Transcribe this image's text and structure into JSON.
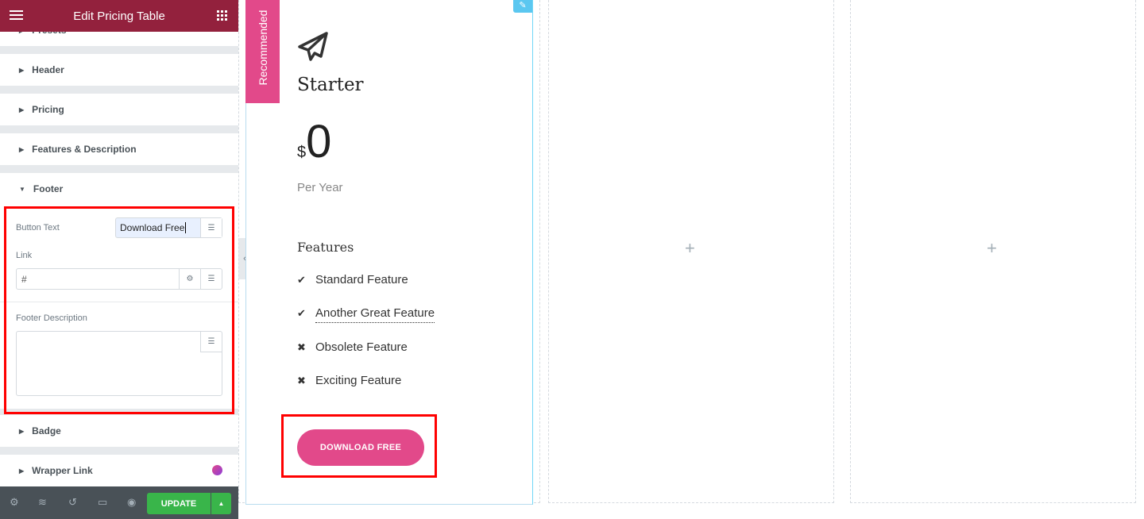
{
  "panel": {
    "title": "Edit Pricing Table",
    "menu_icon": "hamburger-icon",
    "grid_icon": "grid-icon"
  },
  "sections": {
    "presets": "Presets",
    "header": "Header",
    "pricing": "Pricing",
    "features": "Features & Description",
    "footer": "Footer",
    "badge": "Badge",
    "wrapper_link": "Wrapper Link"
  },
  "footer_controls": {
    "button_text_label": "Button Text",
    "button_text_value": "Download Free",
    "link_label": "Link",
    "link_value": "#",
    "description_label": "Footer Description",
    "description_value": ""
  },
  "bottom": {
    "update": "UPDATE"
  },
  "card": {
    "badge": "Recommended",
    "title": "Starter",
    "currency": "$",
    "price": "0",
    "period": "Per Year",
    "features_title": "Features",
    "features": [
      {
        "text": "Standard Feature",
        "icon": "check"
      },
      {
        "text": "Another Great Feature",
        "icon": "check"
      },
      {
        "text": "Obsolete Feature",
        "icon": "times"
      },
      {
        "text": "Exciting Feature",
        "icon": "times"
      }
    ],
    "button": "DOWNLOAD FREE"
  },
  "colors": {
    "header": "#93213d",
    "accent": "#e2498a",
    "update": "#39b54a",
    "highlight": "#ff0000"
  }
}
